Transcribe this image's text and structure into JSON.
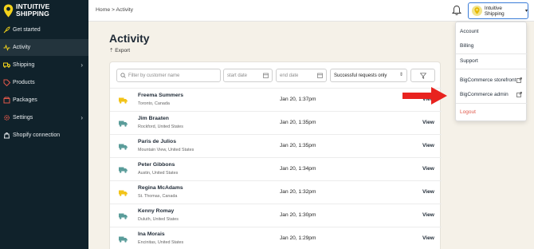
{
  "brand": {
    "line1": "INTUITIVE",
    "line2": "SHIPPING",
    "accent": "#f2d21b"
  },
  "sidebar": {
    "items": [
      {
        "label": "Get started",
        "icon": "rocket-icon"
      },
      {
        "label": "Activity",
        "icon": "activity-icon",
        "active": true
      },
      {
        "label": "Shipping",
        "icon": "truck-icon",
        "chevron": true
      },
      {
        "label": "Products",
        "icon": "tag-icon"
      },
      {
        "label": "Packages",
        "icon": "box-icon"
      },
      {
        "label": "Settings",
        "icon": "gear-icon",
        "chevron": true
      },
      {
        "label": "Shopify connection",
        "icon": "shopify-icon"
      }
    ]
  },
  "header": {
    "breadcrumb": "Home > Activity",
    "account_label": "Intuitive Shipping"
  },
  "dropdown": {
    "items": [
      "Account",
      "Billing",
      "Support",
      "BigCommerce storefront",
      "BigCommerce admin",
      "Logout"
    ]
  },
  "page": {
    "title": "Activity",
    "export_label": "Export"
  },
  "filters": {
    "customer_placeholder": "Filter by customer name",
    "start_placeholder": "start date",
    "end_placeholder": "end date",
    "status_value": "Successful requests only"
  },
  "rows": [
    {
      "name": "Freema Summers",
      "location": "Toronto, Canada",
      "date": "Jan 20, 1:37pm",
      "action": "View",
      "status_color": "#f2c318"
    },
    {
      "name": "Jim Braaten",
      "location": "Rockford, United States",
      "date": "Jan 20, 1:35pm",
      "action": "View",
      "status_color": "#5a9c9a"
    },
    {
      "name": "Paris de Julios",
      "location": "Mountain View, United States",
      "date": "Jan 20, 1:35pm",
      "action": "View",
      "status_color": "#5a9c9a"
    },
    {
      "name": "Peter Gibbons",
      "location": "Austin, United States",
      "date": "Jan 20, 1:34pm",
      "action": "View",
      "status_color": "#5a9c9a"
    },
    {
      "name": "Regina McAdams",
      "location": "St. Thomas, Canada",
      "date": "Jan 20, 1:32pm",
      "action": "View",
      "status_color": "#f2c318"
    },
    {
      "name": "Kenny Romay",
      "location": "Duluth, United States",
      "date": "Jan 20, 1:30pm",
      "action": "View",
      "status_color": "#5a9c9a"
    },
    {
      "name": "Ina Morais",
      "location": "Encinitas, United States",
      "date": "Jan 20, 1:29pm",
      "action": "View",
      "status_color": "#5a9c9a"
    }
  ]
}
